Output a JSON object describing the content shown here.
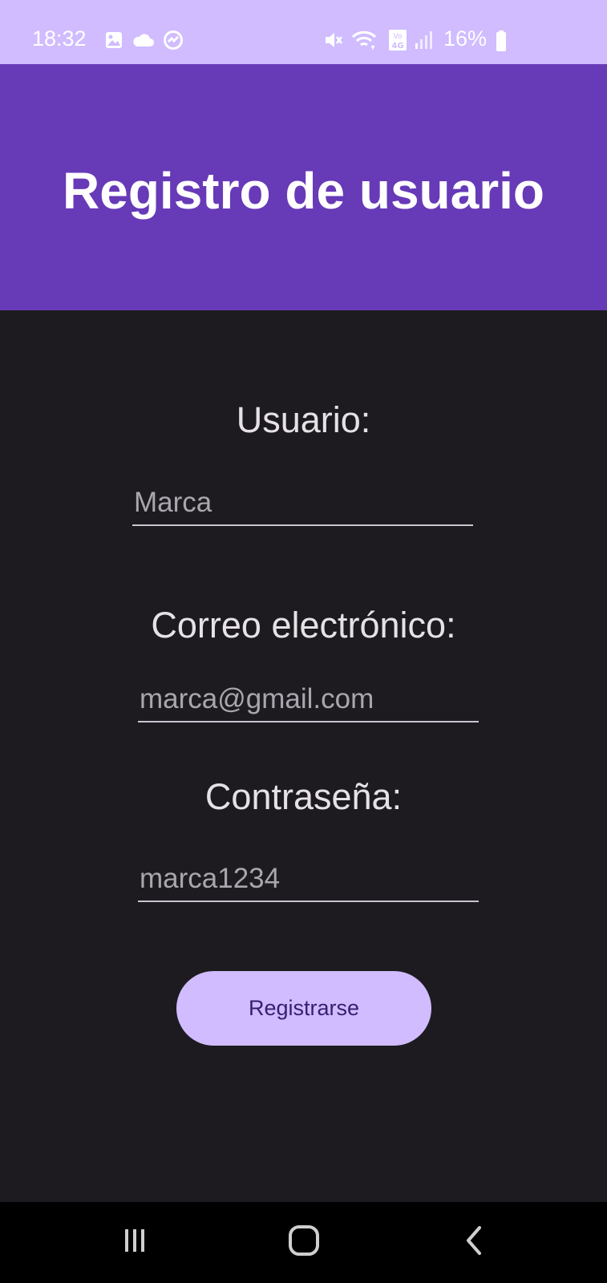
{
  "status_bar": {
    "time": "18:32",
    "battery_percent": "16%",
    "left_icons": [
      "gallery-icon",
      "cloud-icon",
      "sync-icon"
    ],
    "right_icons": [
      "mute-icon",
      "wifi-icon",
      "volte-4g-icon",
      "signal-icon",
      "battery-icon"
    ],
    "background_color": "#d0bcff"
  },
  "app_bar": {
    "title": "Registro de usuario",
    "background_color": "#673ab7"
  },
  "form": {
    "username": {
      "label": "Usuario:",
      "value": "Marca"
    },
    "email": {
      "label": "Correo electrónico:",
      "value": "marca@gmail.com"
    },
    "password": {
      "label": "Contraseña:",
      "value": "marca1234"
    },
    "submit_label": "Registrarse",
    "submit_color": "#d0bcff"
  },
  "nav_bar": {
    "buttons": [
      "recent-apps-icon",
      "home-icon",
      "back-icon"
    ]
  }
}
